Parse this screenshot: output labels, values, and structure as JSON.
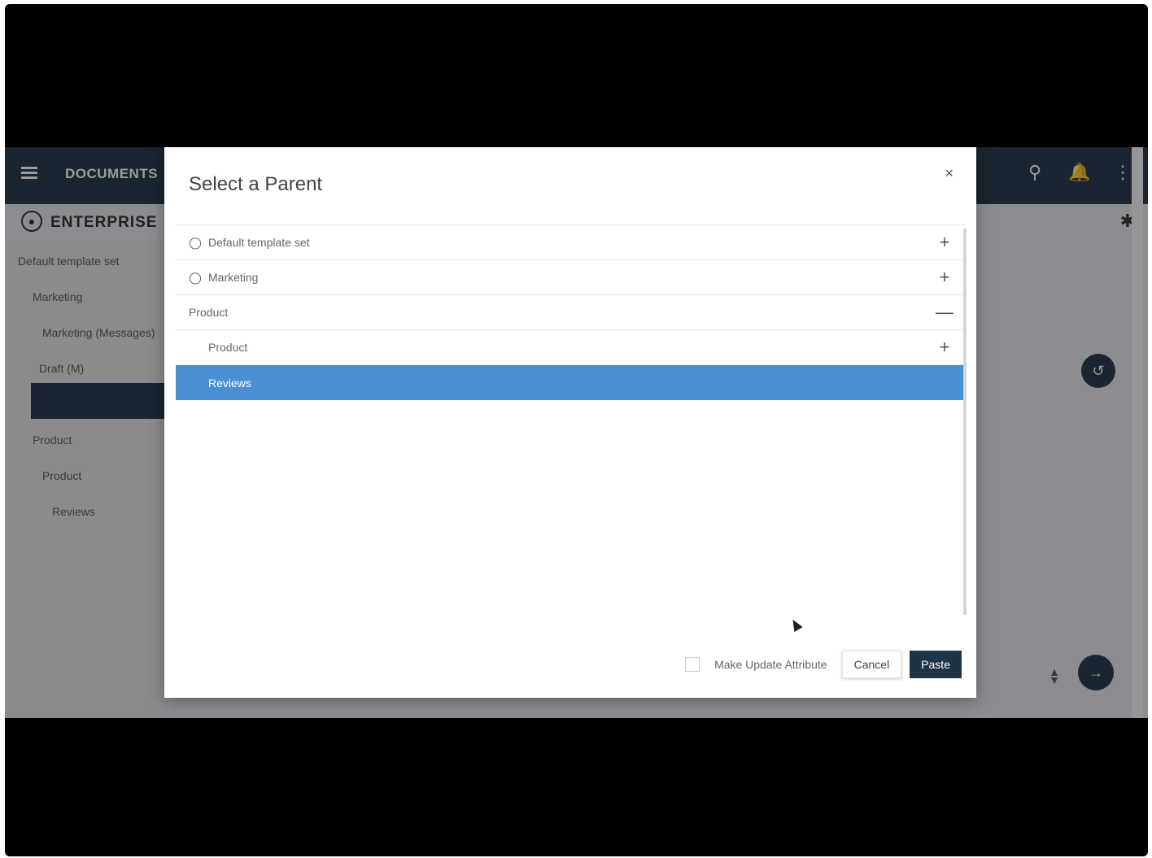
{
  "app": {
    "title": "DOCUMENTS",
    "logo_text": "ENTERPRISE"
  },
  "sidebar": {
    "items": [
      {
        "label": "Default template set"
      },
      {
        "label": "Marketing"
      },
      {
        "label": "Marketing (Messages)"
      },
      {
        "label": "Draft (M)"
      },
      {
        "label": "Product"
      },
      {
        "label": "Product"
      },
      {
        "label": "Reviews"
      }
    ]
  },
  "dialog": {
    "title": "Select a Parent",
    "close_label": "×",
    "rows": [
      {
        "label": "Default template set",
        "toggle": "+"
      },
      {
        "label": "Marketing",
        "toggle": "+"
      },
      {
        "label": "Product",
        "toggle": "—"
      },
      {
        "label": "Product",
        "toggle": "+"
      },
      {
        "label": "Reviews",
        "toggle": ""
      }
    ],
    "checkbox_label": "Make Update Attribute",
    "cancel_label": "Cancel",
    "paste_label": "Paste"
  },
  "colors": {
    "header": "#1f3347",
    "selected_row": "#4a8fd2",
    "primary_button": "#1f3347"
  },
  "icons": [
    "menu-icon",
    "search-icon",
    "bell-icon",
    "more-vert-icon",
    "globe-icon",
    "close-icon",
    "history-icon",
    "share-icon"
  ]
}
